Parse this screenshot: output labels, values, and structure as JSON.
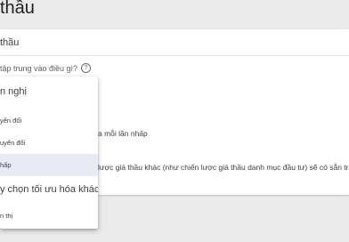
{
  "page": {
    "title": "thầu"
  },
  "card": {
    "section_title": "thầu",
    "focus_question": "tập trung vào điều gì?",
    "pay_text": "a mỗi lần nhấp",
    "strategy_text": "lược giá thầu khác (như chiến lược giá thầu danh mục đầu tư) sẽ có sẵn trong"
  },
  "dropdown": {
    "options": [
      {
        "label": "n nghị"
      },
      {
        "label": "yển đổi"
      },
      {
        "label": "uyển đổi"
      },
      {
        "label": "hấp"
      },
      {
        "label": "y chọn tối ưu hóa khác"
      },
      {
        "label": "n thị"
      }
    ],
    "selected_index": 3
  },
  "colors": {
    "selected_bg": "#e8eaf4",
    "page_bg": "#eaeaea"
  }
}
